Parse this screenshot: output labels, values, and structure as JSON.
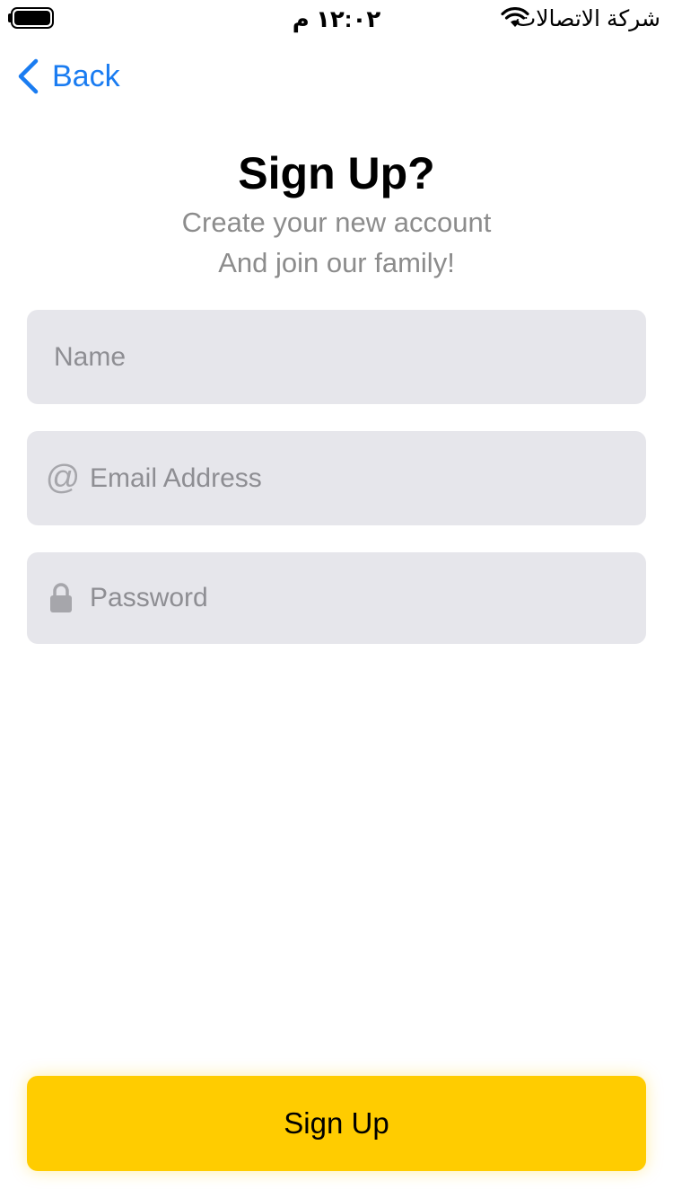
{
  "status_bar": {
    "time": "١٢:٠٢ م",
    "carrier": "شركة الاتصالات"
  },
  "nav": {
    "back_label": "Back"
  },
  "header": {
    "title": "Sign Up?",
    "subtitle_line1": "Create your new account",
    "subtitle_line2": "And join our family!"
  },
  "form": {
    "name": {
      "placeholder": "Name",
      "value": ""
    },
    "email": {
      "placeholder": "Email Address",
      "value": "",
      "icon": "at-icon"
    },
    "password": {
      "placeholder": "Password",
      "value": "",
      "icon": "lock-icon"
    }
  },
  "actions": {
    "signup_label": "Sign Up"
  },
  "colors": {
    "accent": "#ffcc00",
    "link": "#1a7cf1",
    "field_bg": "#e6e6eb",
    "subtitle": "#8c8c8c"
  }
}
